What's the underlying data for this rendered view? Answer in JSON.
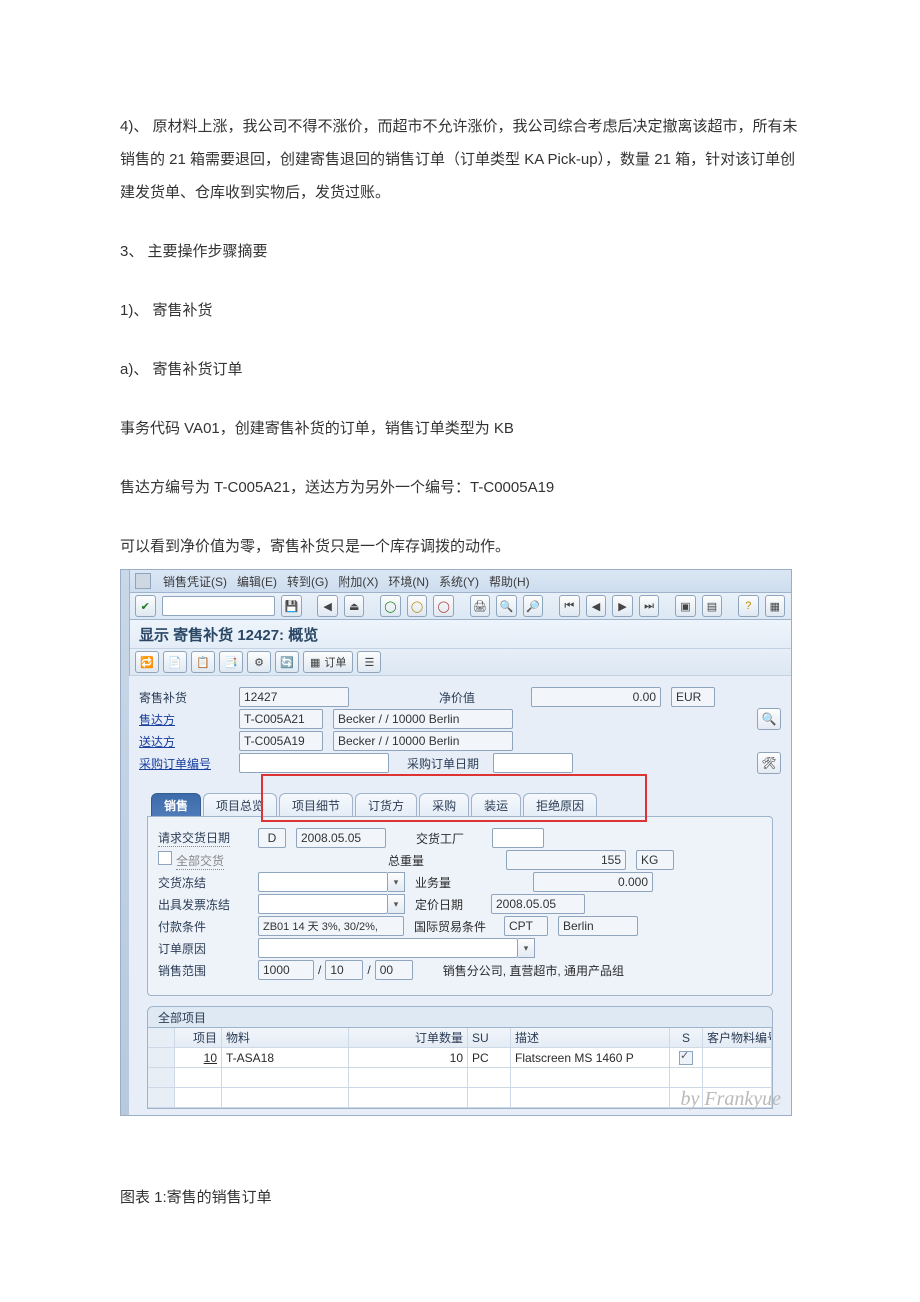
{
  "doc": {
    "p1": "4)、 原材料上涨，我公司不得不涨价，而超市不允许涨价，我公司综合考虑后决定撤离该超市，所有未销售的 21 箱需要退回，创建寄售退回的销售订单（订单类型 KA Pick-up），数量 21 箱，针对该订单创建发货单、仓库收到实物后，发货过账。",
    "p2": "3、 主要操作步骤摘要",
    "p3": "1)、 寄售补货",
    "p4": "a)、 寄售补货订单",
    "p5": "事务代码 VA01，创建寄售补货的订单，销售订单类型为 KB",
    "p6": "售达方编号为 T-C005A21，送达方为另外一个编号：T-C0005A19",
    "p7": "可以看到净价值为零，寄售补货只是一个库存调拨的动作。",
    "caption": "图表 1:寄售的销售订单"
  },
  "menu": {
    "m1": "销售凭证(S)",
    "m2": "编辑(E)",
    "m3": "转到(G)",
    "m4": "附加(X)",
    "m5": "环境(N)",
    "m6": "系统(Y)",
    "m7": "帮助(H)"
  },
  "title": "显示 寄售补货 12427: 概览",
  "apptb": {
    "orders_label": "订单"
  },
  "head": {
    "type_label": "寄售补货",
    "doc_no": "12427",
    "netval_label": "净价值",
    "netval": "0.00",
    "curr": "EUR",
    "soldto_label": "售达方",
    "soldto_code": "T-C005A21",
    "soldto_name": "Becker / / 10000 Berlin",
    "shipto_label": "送达方",
    "shipto_code": "T-C005A19",
    "shipto_name": "Becker / / 10000 Berlin",
    "po_label": "采购订单编号",
    "podate_label": "采购订单日期"
  },
  "tabs": {
    "t1": "销售",
    "t2": "项目总览",
    "t3": "项目细节",
    "t4": "订货方",
    "t5": "采购",
    "t6": "装运",
    "t7": "拒绝原因"
  },
  "sales": {
    "reqdate_label": "请求交货日期",
    "reqdate_type": "D",
    "reqdate": "2008.05.05",
    "plant_label": "交货工厂",
    "complete_label": "全部交货",
    "gw_label": "总重量",
    "gw_val": "155",
    "gw_u": "KG",
    "delblock_label": "交货冻结",
    "vol_label": "业务量",
    "vol_val": "0.000",
    "billblock_label": "出具发票冻结",
    "prdate_label": "定价日期",
    "prdate": "2008.05.05",
    "pterm_label": "付款条件",
    "pterm": "ZB01 14 天 3%, 30/2%,",
    "inco_label": "国际贸易条件",
    "inco1": "CPT",
    "inco2": "Berlin",
    "ordreason_label": "订单原因",
    "area_label": "销售范围",
    "area1": "1000",
    "area2": "10",
    "area3": "00",
    "area_text": "销售分公司, 直营超市, 通用产品组"
  },
  "items": {
    "section": "全部项目",
    "h_item": "项目",
    "h_mat": "物料",
    "h_qty": "订单数量",
    "h_su": "SU",
    "h_desc": "描述",
    "h_s": "S",
    "h_cust": "客户物料编号",
    "r1_item": "10",
    "r1_mat": "T-ASA18",
    "r1_qty": "10",
    "r1_su": "PC",
    "r1_desc": "Flatscreen MS 1460 P"
  },
  "watermark": "by Frankyue"
}
